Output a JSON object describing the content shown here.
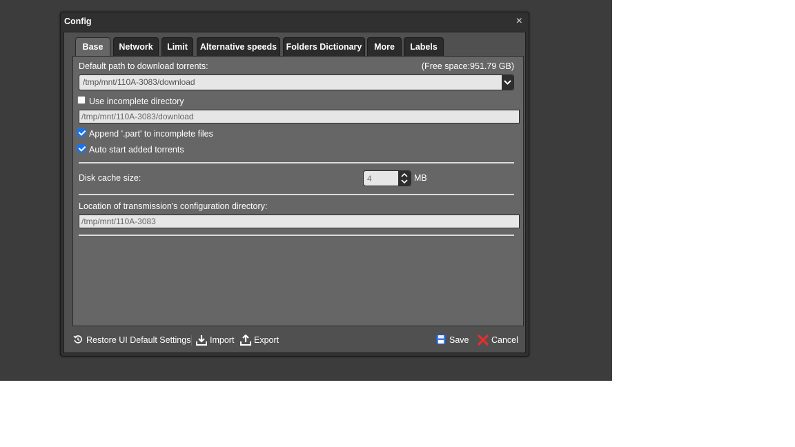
{
  "dialog": {
    "title": "Config",
    "close_label": "×"
  },
  "tabs": [
    {
      "label": "Base",
      "active": true
    },
    {
      "label": "Network"
    },
    {
      "label": "Limit"
    },
    {
      "label": "Alternative speeds"
    },
    {
      "label": "Folders Dictionary"
    },
    {
      "label": "More"
    },
    {
      "label": "Labels"
    }
  ],
  "base": {
    "download_path_label": "Default path to download torrents:",
    "free_space": "(Free space:951.79 GB)",
    "download_path_value": "/tmp/mnt/110A-3083/download",
    "use_incomplete_label": "Use incomplete directory",
    "use_incomplete_checked": false,
    "incomplete_dir_value": "/tmp/mnt/110A-3083/download",
    "append_part_label": "Append '.part' to incomplete files",
    "append_part_checked": true,
    "auto_start_label": "Auto start added torrents",
    "auto_start_checked": true,
    "disk_cache_label": "Disk cache size:",
    "disk_cache_value": "4",
    "disk_cache_unit": "MB",
    "config_dir_label": "Location of transmission's configuration directory:",
    "config_dir_value": "/tmp/mnt/110A-3083"
  },
  "footer": {
    "restore_label": "Restore UI Default Settings",
    "import_label": "Import",
    "export_label": "Export",
    "save_label": "Save",
    "cancel_label": "Cancel"
  },
  "colors": {
    "backdrop": "#3c3c3c",
    "panel": "#666666",
    "checkbox_accent": "#1a73e8",
    "cancel_icon": "#e03030",
    "save_icon": "#3b78e7"
  }
}
